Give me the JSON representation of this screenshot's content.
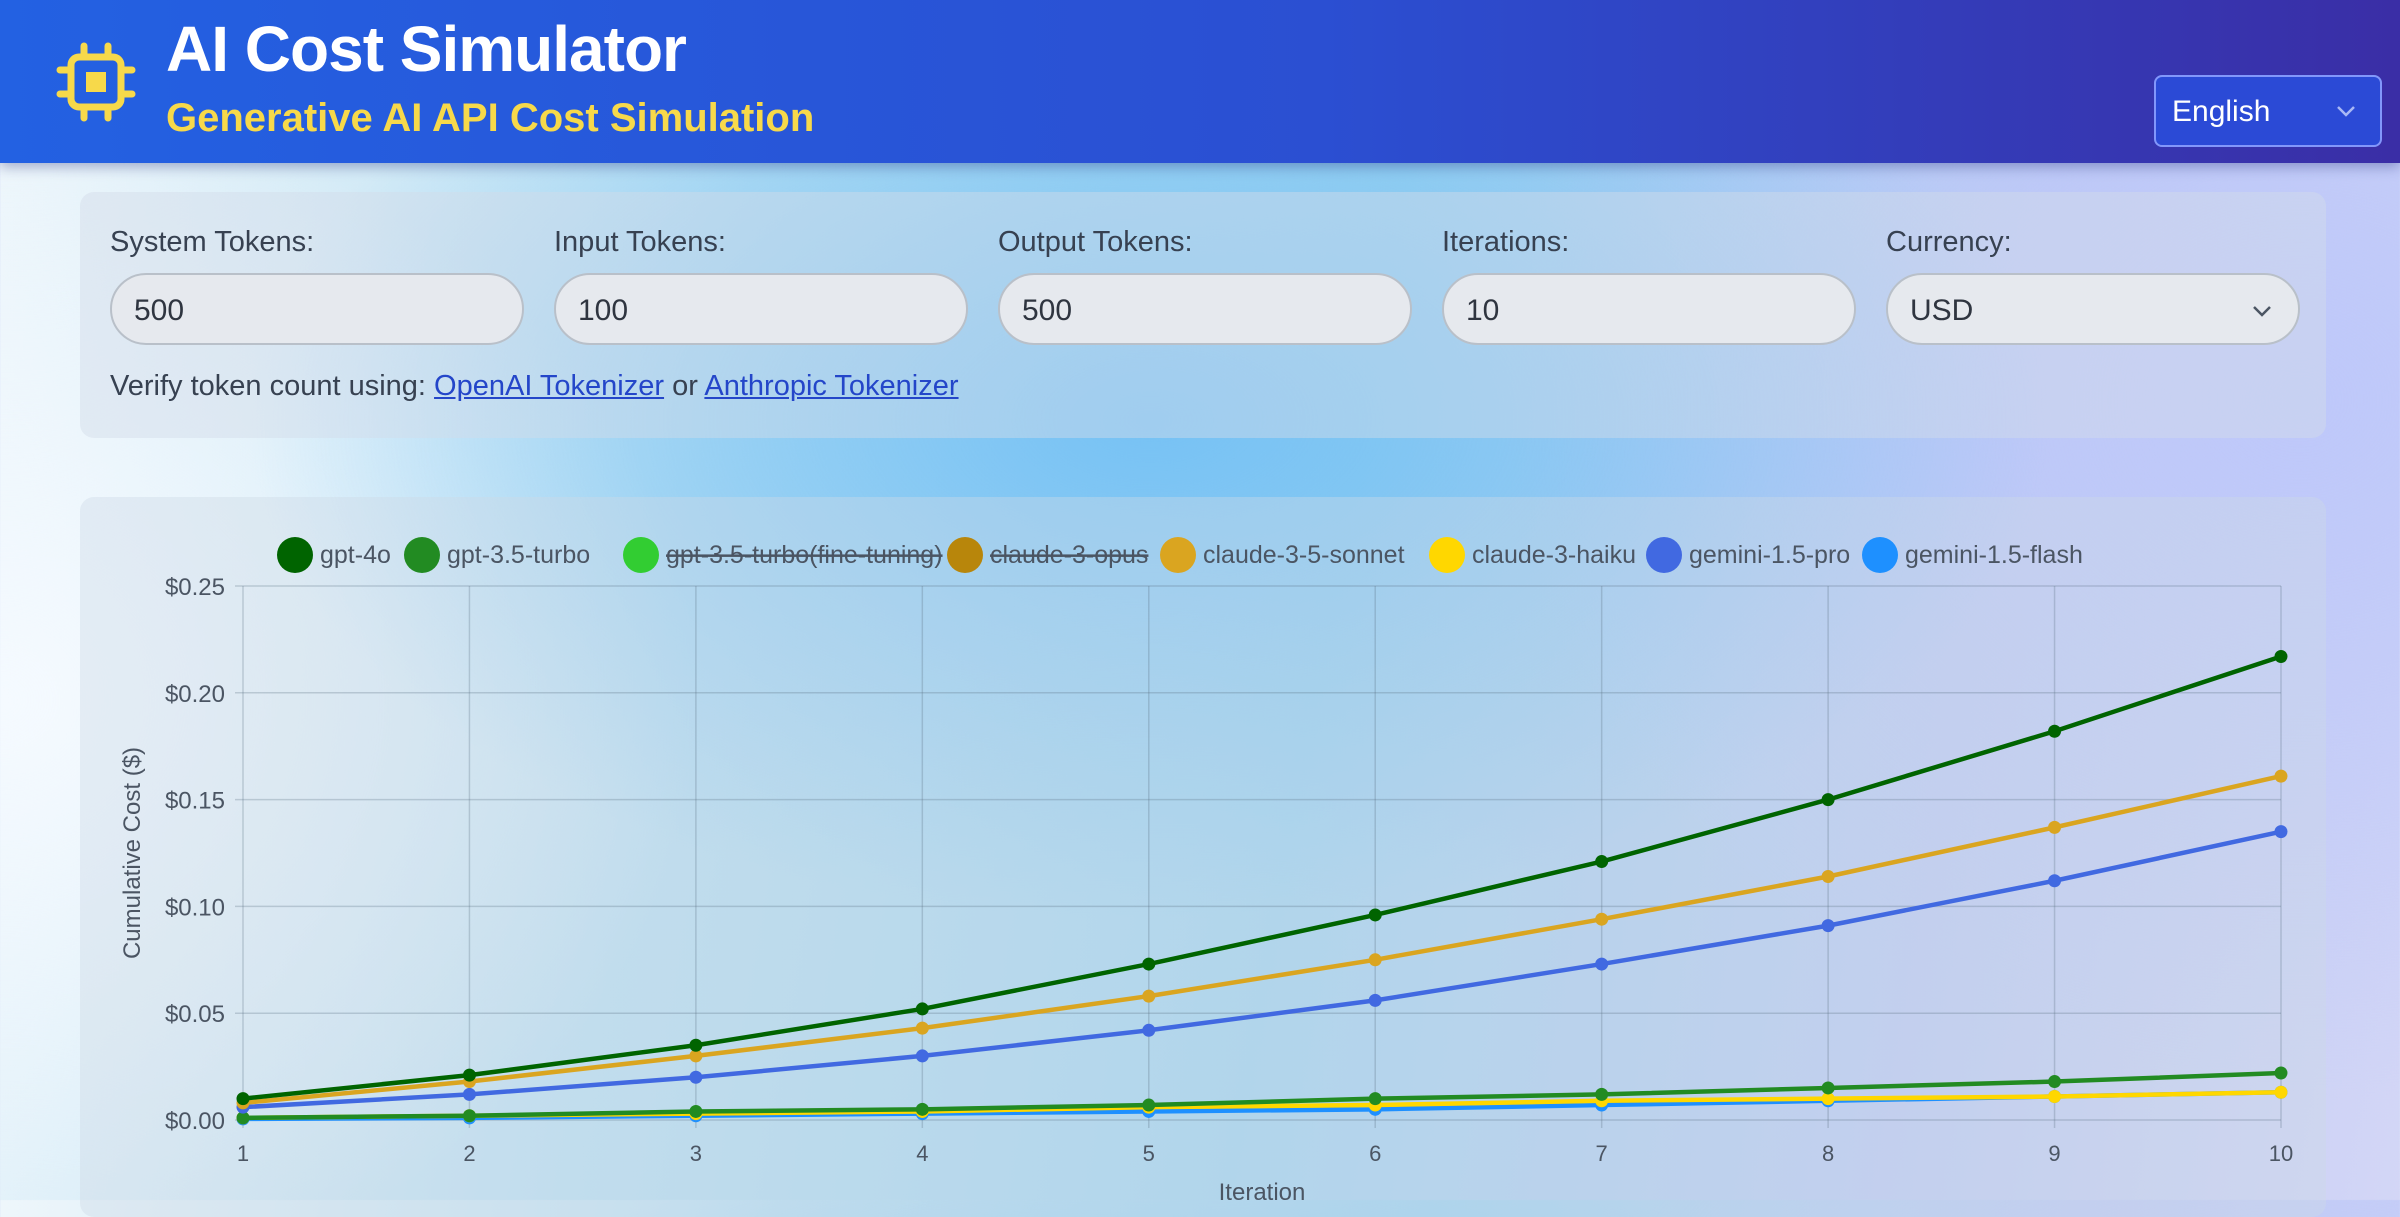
{
  "header": {
    "title": "AI Cost Simulator",
    "subtitle": "Generative AI API Cost Simulation",
    "language": "English",
    "logo_icon": "chip-icon"
  },
  "form": {
    "fields": [
      {
        "label": "System Tokens:",
        "value": "500"
      },
      {
        "label": "Input Tokens:",
        "value": "100"
      },
      {
        "label": "Output Tokens:",
        "value": "500"
      },
      {
        "label": "Iterations:",
        "value": "10"
      },
      {
        "label": "Currency:",
        "value": "USD"
      }
    ],
    "verify_prefix": "Verify token count using:",
    "verify_link1": "OpenAI Tokenizer",
    "verify_or": "or",
    "verify_link2": "Anthropic Tokenizer"
  },
  "chart_data": {
    "type": "line",
    "ylabel": "Cumulative Cost ($)",
    "xlabel": "Iteration",
    "x": [
      1,
      2,
      3,
      4,
      5,
      6,
      7,
      8,
      9,
      10
    ],
    "ylim": [
      0,
      0.25
    ],
    "yticks": [
      "$0.00",
      "$0.05",
      "$0.10",
      "$0.15",
      "$0.20",
      "$0.25"
    ],
    "grid": true,
    "legend_position": "top",
    "series": [
      {
        "name": "gpt-4o",
        "color": "#006400",
        "hidden": false,
        "values": [
          0.01,
          0.021,
          0.035,
          0.052,
          0.073,
          0.096,
          0.121,
          0.15,
          0.182,
          0.217
        ]
      },
      {
        "name": "gpt-3.5-turbo",
        "color": "#228b22",
        "hidden": false,
        "values": [
          0.001,
          0.002,
          0.004,
          0.005,
          0.007,
          0.01,
          0.012,
          0.015,
          0.018,
          0.022
        ]
      },
      {
        "name": "gpt-3.5-turbo(fine-tuning)",
        "color": "#32cd32",
        "hidden": true,
        "values": []
      },
      {
        "name": "claude-3-opus",
        "color": "#b8860b",
        "hidden": true,
        "values": []
      },
      {
        "name": "claude-3-5-sonnet",
        "color": "#daa520",
        "hidden": false,
        "values": [
          0.008,
          0.018,
          0.03,
          0.043,
          0.058,
          0.075,
          0.094,
          0.114,
          0.137,
          0.161
        ]
      },
      {
        "name": "claude-3-haiku",
        "color": "#ffd700",
        "hidden": false,
        "values": [
          0.001,
          0.002,
          0.003,
          0.004,
          0.006,
          0.007,
          0.009,
          0.01,
          0.011,
          0.013
        ]
      },
      {
        "name": "gemini-1.5-pro",
        "color": "#4169e1",
        "hidden": false,
        "values": [
          0.006,
          0.012,
          0.02,
          0.03,
          0.042,
          0.056,
          0.073,
          0.091,
          0.112,
          0.135
        ]
      },
      {
        "name": "gemini-1.5-flash",
        "color": "#1e90ff",
        "hidden": false,
        "values": [
          0.0005,
          0.001,
          0.002,
          0.003,
          0.004,
          0.005,
          0.007,
          0.009,
          0.011,
          0.013
        ]
      }
    ]
  }
}
